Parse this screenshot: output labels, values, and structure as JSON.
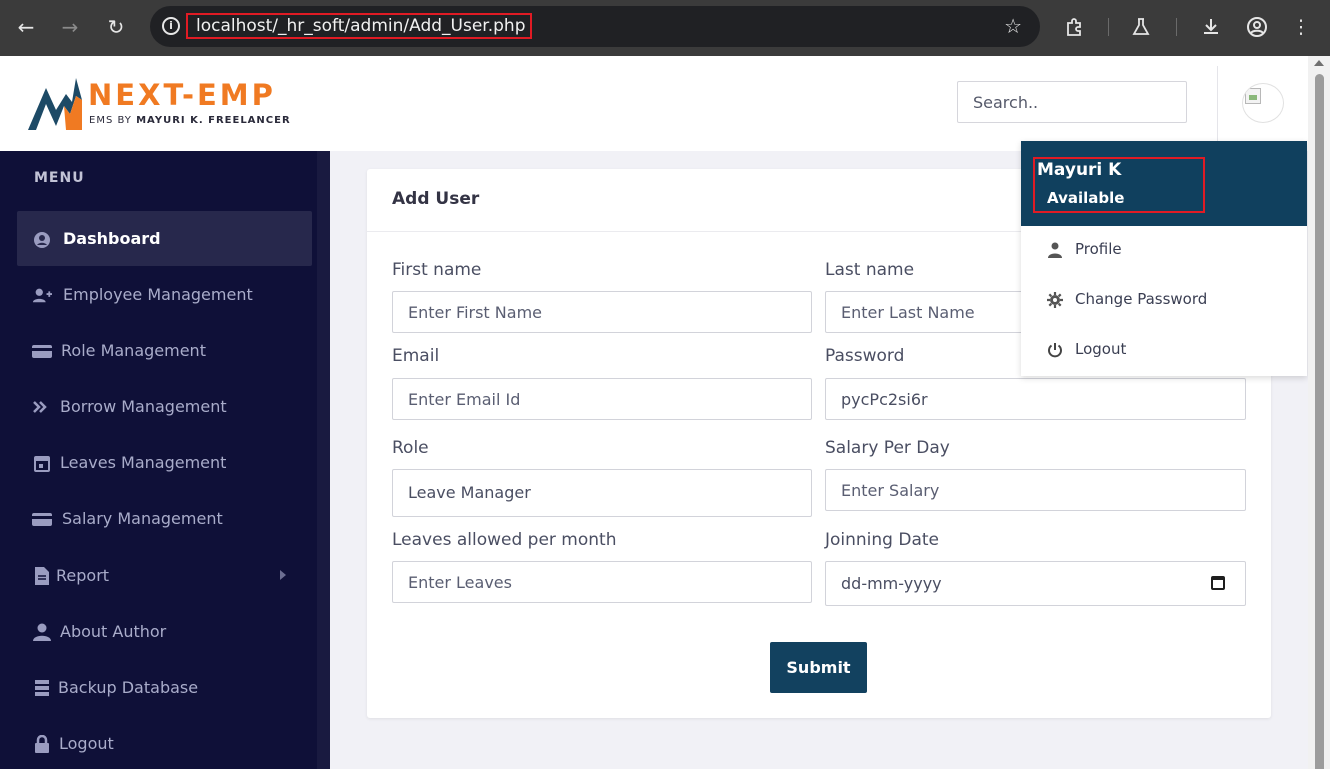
{
  "browser": {
    "url": "localhost/_hr_soft/admin/Add_User.php",
    "icons": [
      "back-arrow-icon",
      "forward-arrow-icon",
      "reload-icon",
      "info-icon",
      "star-icon",
      "extensions-icon",
      "labs-flask-icon",
      "download-icon",
      "account-icon",
      "kebab-menu-icon"
    ]
  },
  "header": {
    "brand": "NEXT-EMP",
    "tagline_prefix": "EMS BY",
    "tagline_author": "MAYURI K. FREELANCER",
    "search_placeholder": "Search.."
  },
  "sidebar": {
    "menu_title": "MENU",
    "items": [
      {
        "label": "Dashboard",
        "icon": "user-circle-icon",
        "active": true
      },
      {
        "label": "Employee Management",
        "icon": "user-plus-icon"
      },
      {
        "label": "Role Management",
        "icon": "card-icon"
      },
      {
        "label": "Borrow Management",
        "icon": "handshake-icon"
      },
      {
        "label": "Leaves Management",
        "icon": "calendar-icon"
      },
      {
        "label": "Salary Management",
        "icon": "card-icon"
      },
      {
        "label": "Report",
        "icon": "file-icon",
        "has_submenu": true
      },
      {
        "label": "About Author",
        "icon": "user-icon"
      },
      {
        "label": "Backup Database",
        "icon": "database-icon"
      },
      {
        "label": "Logout",
        "icon": "lock-icon"
      }
    ]
  },
  "form": {
    "title": "Add User",
    "first_name_label": "First name",
    "first_name_placeholder": "Enter First Name",
    "last_name_label": "Last name",
    "last_name_placeholder": "Enter Last Name",
    "email_label": "Email",
    "email_placeholder": "Enter Email Id",
    "password_label": "Password",
    "password_value": "pycPc2si6r",
    "role_label": "Role",
    "role_value": "Leave Manager",
    "salary_label": "Salary Per Day",
    "salary_placeholder": "Enter Salary",
    "leaves_label": "Leaves allowed per month",
    "leaves_placeholder": "Enter Leaves",
    "date_label": "Joinning Date",
    "date_placeholder": "dd-mm-yyyy",
    "submit_label": "Submit"
  },
  "dropdown": {
    "name": "Mayuri K",
    "status": "Available",
    "items": [
      {
        "label": "Profile",
        "icon": "user-icon"
      },
      {
        "label": "Change Password",
        "icon": "gear-icon"
      },
      {
        "label": "Logout",
        "icon": "power-icon"
      }
    ]
  },
  "colors": {
    "brand_orange": "#f07a22",
    "brand_navy": "#12415f",
    "sidebar_bg": "#0f1038",
    "highlight_red": "#e01b24"
  }
}
